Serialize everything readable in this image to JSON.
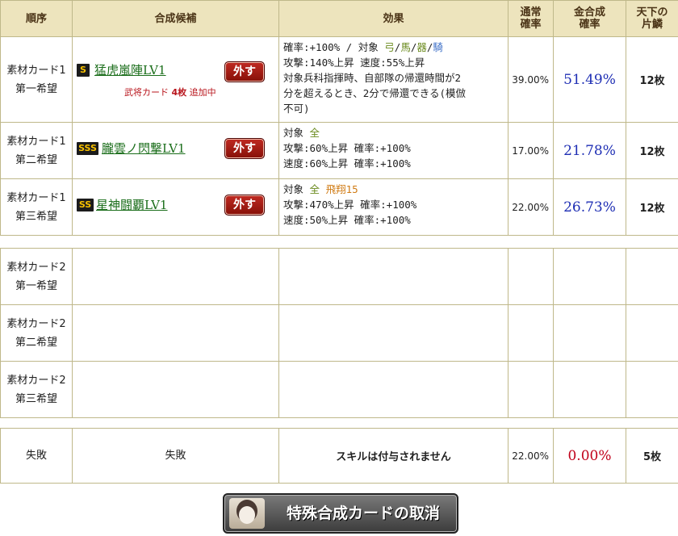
{
  "header": {
    "order": "順序",
    "candidate": "合成候補",
    "effect": "効果",
    "normal_rate": [
      "通常",
      "確率"
    ],
    "gold_rate": [
      "金合成",
      "確率"
    ],
    "shards": [
      "天下の",
      "片鱗"
    ]
  },
  "group1": [
    {
      "slot": [
        "素材カード1",
        "第一希望"
      ],
      "rank": "S",
      "skill": "猛虎嵐陣LV1",
      "remove": "外す",
      "note_prefix": "武将カード",
      "note_count": "4枚",
      "note_suffix": "追加中",
      "effect_lines": [
        [
          {
            "t": "確率:+100% / 対象 "
          },
          {
            "t": "弓",
            "c": "grn"
          },
          {
            "t": "/"
          },
          {
            "t": "馬",
            "c": "grn"
          },
          {
            "t": "/"
          },
          {
            "t": "器",
            "c": "grn"
          },
          {
            "t": "/"
          },
          {
            "t": "騎",
            "c": "blu"
          }
        ],
        [
          {
            "t": "攻撃:140%上昇 速度:55%上昇"
          }
        ],
        [
          {
            "t": "対象兵科指揮時、自部隊の帰還時間が2"
          }
        ],
        [
          {
            "t": "分を超えるとき、2分で帰還できる(模倣"
          }
        ],
        [
          {
            "t": "不可)"
          }
        ]
      ],
      "normal_rate": "39.00%",
      "gold_rate": "51.49%",
      "shards": "12枚"
    },
    {
      "slot": [
        "素材カード1",
        "第二希望"
      ],
      "rank": "SSS",
      "skill": "朧雲ノ閃撃LV1",
      "remove": "外す",
      "effect_lines": [
        [
          {
            "t": "対象 "
          },
          {
            "t": "全",
            "c": "grn"
          }
        ],
        [
          {
            "t": "攻撃:60%上昇 確率:+100%"
          }
        ],
        [
          {
            "t": "速度:60%上昇 確率:+100%"
          }
        ]
      ],
      "normal_rate": "17.00%",
      "gold_rate": "21.78%",
      "shards": "12枚"
    },
    {
      "slot": [
        "素材カード1",
        "第三希望"
      ],
      "rank": "SS",
      "skill": "星神闘覇LV1",
      "remove": "外す",
      "effect_lines": [
        [
          {
            "t": "対象 "
          },
          {
            "t": "全",
            "c": "grn"
          },
          {
            "t": " "
          },
          {
            "t": "飛翔15",
            "c": "org"
          }
        ],
        [
          {
            "t": "攻撃:470%上昇 確率:+100%"
          }
        ],
        [
          {
            "t": "速度:50%上昇 確率:+100%"
          }
        ]
      ],
      "normal_rate": "22.00%",
      "gold_rate": "26.73%",
      "shards": "12枚"
    }
  ],
  "group2": [
    {
      "slot": [
        "素材カード2",
        "第一希望"
      ]
    },
    {
      "slot": [
        "素材カード2",
        "第二希望"
      ]
    },
    {
      "slot": [
        "素材カード2",
        "第三希望"
      ]
    }
  ],
  "failure": {
    "order": "失敗",
    "candidate": "失敗",
    "effect": "スキルは付与されません",
    "normal_rate": "22.00%",
    "gold_rate": "0.00%",
    "shards": "5枚"
  },
  "cancel_button": "特殊合成カードの取消",
  "colors": {
    "header_bg": "#ede4bd",
    "border": "#bfb88a",
    "gold_rate": "#1f2fb4",
    "fail_rate": "#c0001a",
    "skill_link": "#1b6e1b"
  },
  "icons": {
    "cancel": "portrait-icon",
    "rank": "rank-badge-icon"
  }
}
